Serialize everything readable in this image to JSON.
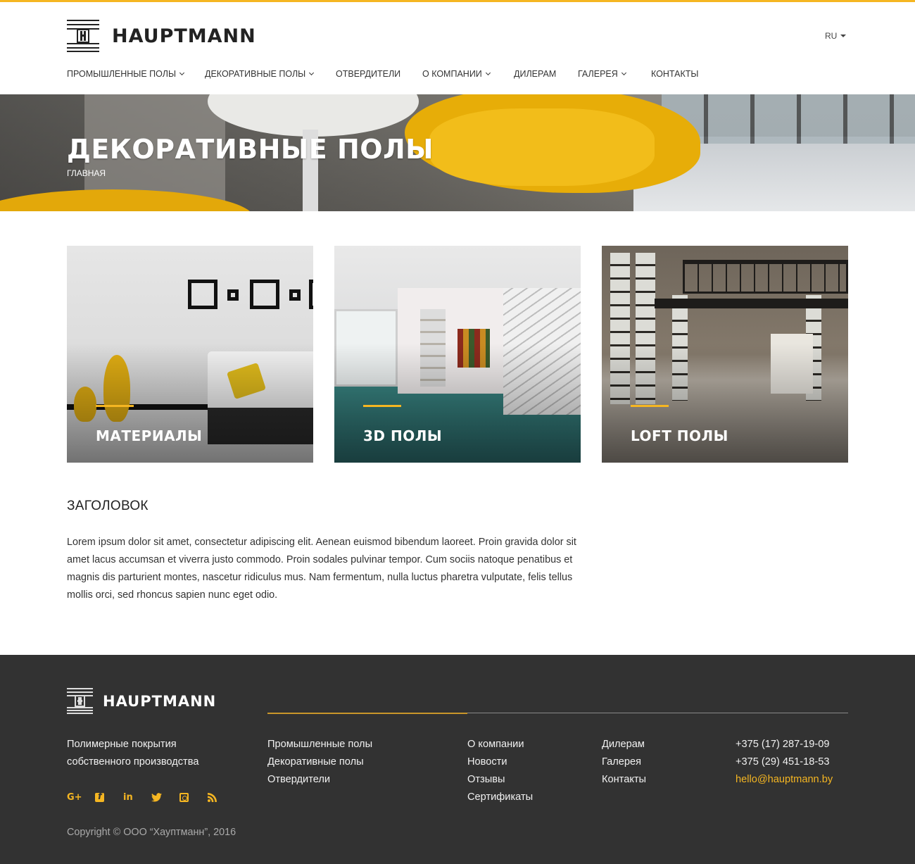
{
  "brand": {
    "name": "HAUPTMANN",
    "accent_color": "#f5b622",
    "footer_bg": "#323232"
  },
  "header": {
    "language": "RU",
    "nav": [
      {
        "label": "ПРОМЫШЛЕННЫЕ ПОЛЫ",
        "has_dropdown": true
      },
      {
        "label": "ДЕКОРАТИВНЫЕ ПОЛЫ",
        "has_dropdown": true
      },
      {
        "label": "ОТВЕРДИТЕЛИ",
        "has_dropdown": false
      },
      {
        "label": "О КОМПАНИИ",
        "has_dropdown": true
      },
      {
        "label": "ДИЛЕРАМ",
        "has_dropdown": false
      },
      {
        "label": "ГАЛЕРЕЯ",
        "has_dropdown": true
      },
      {
        "label": "КОНТАКТЫ",
        "has_dropdown": false
      }
    ]
  },
  "hero": {
    "title": "ДЕКОРАТИВНЫЕ ПОЛЫ",
    "breadcrumb": "ГЛАВНАЯ"
  },
  "cards": [
    {
      "label": "МАТЕРИАЛЫ"
    },
    {
      "label": "3D ПОЛЫ"
    },
    {
      "label": "LOFT ПОЛЫ"
    }
  ],
  "content": {
    "heading": "ЗАГОЛОВОК",
    "body": "Lorem ipsum dolor sit amet, consectetur adipiscing elit. Aenean euismod bibendum laoreet. Proin gravida dolor sit amet lacus accumsan et viverra justo commodo. Proin sodales pulvinar tempor. Cum sociis natoque penatibus et magnis dis parturient montes, nascetur ridiculus mus. Nam fermentum, nulla luctus pharetra vulputate, felis tellus mollis orci, sed rhoncus sapien nunc eget odio."
  },
  "footer": {
    "brand_name": "HAUPTMANN",
    "tagline": [
      "Полимерные покрытия",
      "собственного  производства"
    ],
    "social": [
      "google-plus-icon",
      "facebook-icon",
      "linkedin-icon",
      "twitter-icon",
      "instagram-icon",
      "rss-icon"
    ],
    "col1": [
      "Промышленные полы",
      "Декоративные полы",
      "Отвердители"
    ],
    "col2": [
      "О компании",
      "Новости",
      "Отзывы",
      "Сертификаты"
    ],
    "col3": [
      "Дилерам",
      "Галерея",
      "Контакты"
    ],
    "contacts": {
      "phone1": "+375 (17) 287-19-09",
      "phone2": "+375 (29) 451-18-53",
      "email": "hello@hauptmann.by"
    },
    "copyright": "Copyright © ООО “Хауптманн”, 2016"
  }
}
